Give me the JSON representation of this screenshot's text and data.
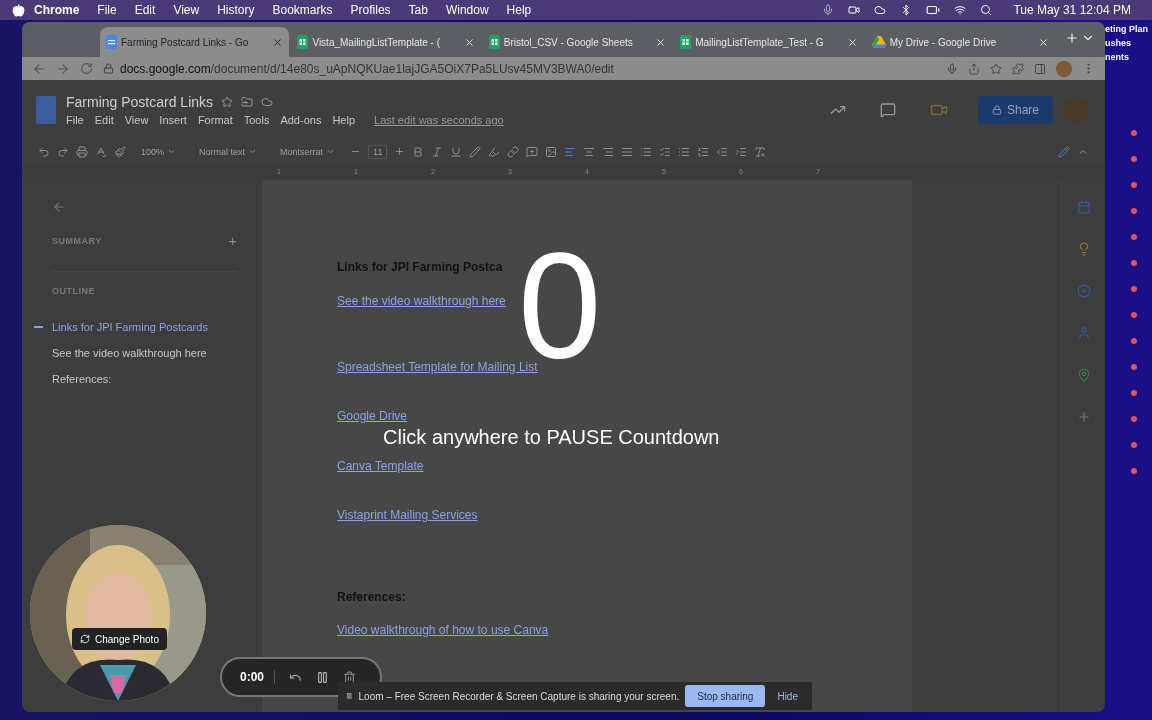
{
  "menubar": {
    "app": "Chrome",
    "menus": [
      "File",
      "Edit",
      "View",
      "History",
      "Bookmarks",
      "Profiles",
      "Tab",
      "Window",
      "Help"
    ],
    "clock": "Tue May 31  12:04 PM"
  },
  "desktop_items": [
    "eting Plan",
    "ushes",
    "nents"
  ],
  "tabs": [
    {
      "title": "Farming Postcard Links - Go",
      "kind": "docs",
      "selected": true
    },
    {
      "title": "Vista_MailingListTemplate - (",
      "kind": "sheets",
      "selected": false
    },
    {
      "title": "Bristol_CSV - Google Sheets",
      "kind": "sheets",
      "selected": false
    },
    {
      "title": "MailingListTemplate_Test - G",
      "kind": "sheets",
      "selected": false
    },
    {
      "title": "My Drive - Google Drive",
      "kind": "drive",
      "selected": false
    }
  ],
  "url": {
    "host": "docs.google.com",
    "path": "/document/d/14e80s_uApNQKUae1lajJGA5OiX7Pa5LUsv45MV3BWA0/edit"
  },
  "doc": {
    "title": "Farming Postcard Links",
    "menus": [
      "File",
      "Edit",
      "View",
      "Insert",
      "Format",
      "Tools",
      "Add-ons",
      "Help"
    ],
    "last_edit": "Last edit was seconds ago",
    "share": "Share"
  },
  "toolbar": {
    "zoom": "100%",
    "style": "Normal text",
    "font": "Montserrat",
    "size": "11"
  },
  "ruler_marks": [
    "1",
    "1",
    "2",
    "3",
    "4",
    "5",
    "6",
    "7"
  ],
  "outline": {
    "summary": "SUMMARY",
    "add": "+",
    "heading": "OUTLINE",
    "items": [
      {
        "text": "Links for JPI Farming Postcards",
        "selected": true
      },
      {
        "text": "See the video walkthrough here",
        "selected": false
      },
      {
        "text": "References:",
        "selected": false
      }
    ]
  },
  "page": {
    "blocks": [
      {
        "kind": "heading",
        "text": "Links for JPI Farming Postca"
      },
      {
        "kind": "link",
        "text": "See the video walkthrough here"
      },
      {
        "kind": "link",
        "text": "Spreadsheet Template for Mailing List"
      },
      {
        "kind": "link",
        "text": "Google Drive"
      },
      {
        "kind": "link",
        "text": "Canva Template"
      },
      {
        "kind": "link",
        "text": "Vistaprint Mailing Services"
      },
      {
        "kind": "heading",
        "text": "References:"
      },
      {
        "kind": "link",
        "text": "Video walkthrough of how to use Canva"
      }
    ]
  },
  "countdown": {
    "number": "0",
    "message": "Click anywhere to PAUSE Countdown"
  },
  "loom": {
    "change_photo": "Change Photo",
    "timer": "0:00",
    "banner": "Loom – Free Screen Recorder & Screen Capture is sharing your screen.",
    "stop": "Stop sharing",
    "hide": "Hide"
  }
}
